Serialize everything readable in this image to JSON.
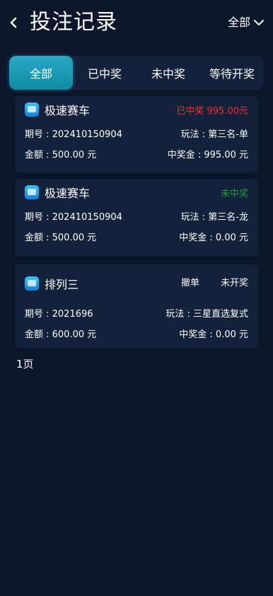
{
  "header": {
    "title": "投注记录",
    "filter_label": "全部"
  },
  "tabs": [
    {
      "label": "全部",
      "active": true
    },
    {
      "label": "已中奖",
      "active": false
    },
    {
      "label": "未中奖",
      "active": false
    },
    {
      "label": "等待开奖",
      "active": false
    }
  ],
  "records": [
    {
      "game": "极速赛车",
      "status": "已中奖 995.00元",
      "status_color": "#ff2a2a",
      "issue": "期号 : 202410150904",
      "play": "玩法 : 第三名-单",
      "amount": "金额 : 500.00 元",
      "prize": "中奖金 : 995.00 元"
    },
    {
      "game": "极速赛车",
      "status": "未中奖",
      "status_color": "#1f9a3a",
      "issue": "期号 : 202410150904",
      "play": "玩法 : 第三名-龙",
      "amount": "金额 : 500.00 元",
      "prize": "中奖金 : 0.00 元"
    },
    {
      "game": "排列三",
      "cancel": "撤单",
      "status": "未开奖",
      "status_color": "#ffffff",
      "issue": "期号 : 2021696",
      "play": "玩法 : 三星直选复式",
      "amount": "金额 : 600.00 元",
      "prize": "中奖金 : 0.00 元"
    }
  ],
  "pagination": {
    "label": "1页"
  },
  "colors": {
    "background": "#0c172b",
    "card": "#14213a",
    "accent": "#1a9fbb",
    "win": "#ff2a2a",
    "lose": "#1f9a3a"
  }
}
